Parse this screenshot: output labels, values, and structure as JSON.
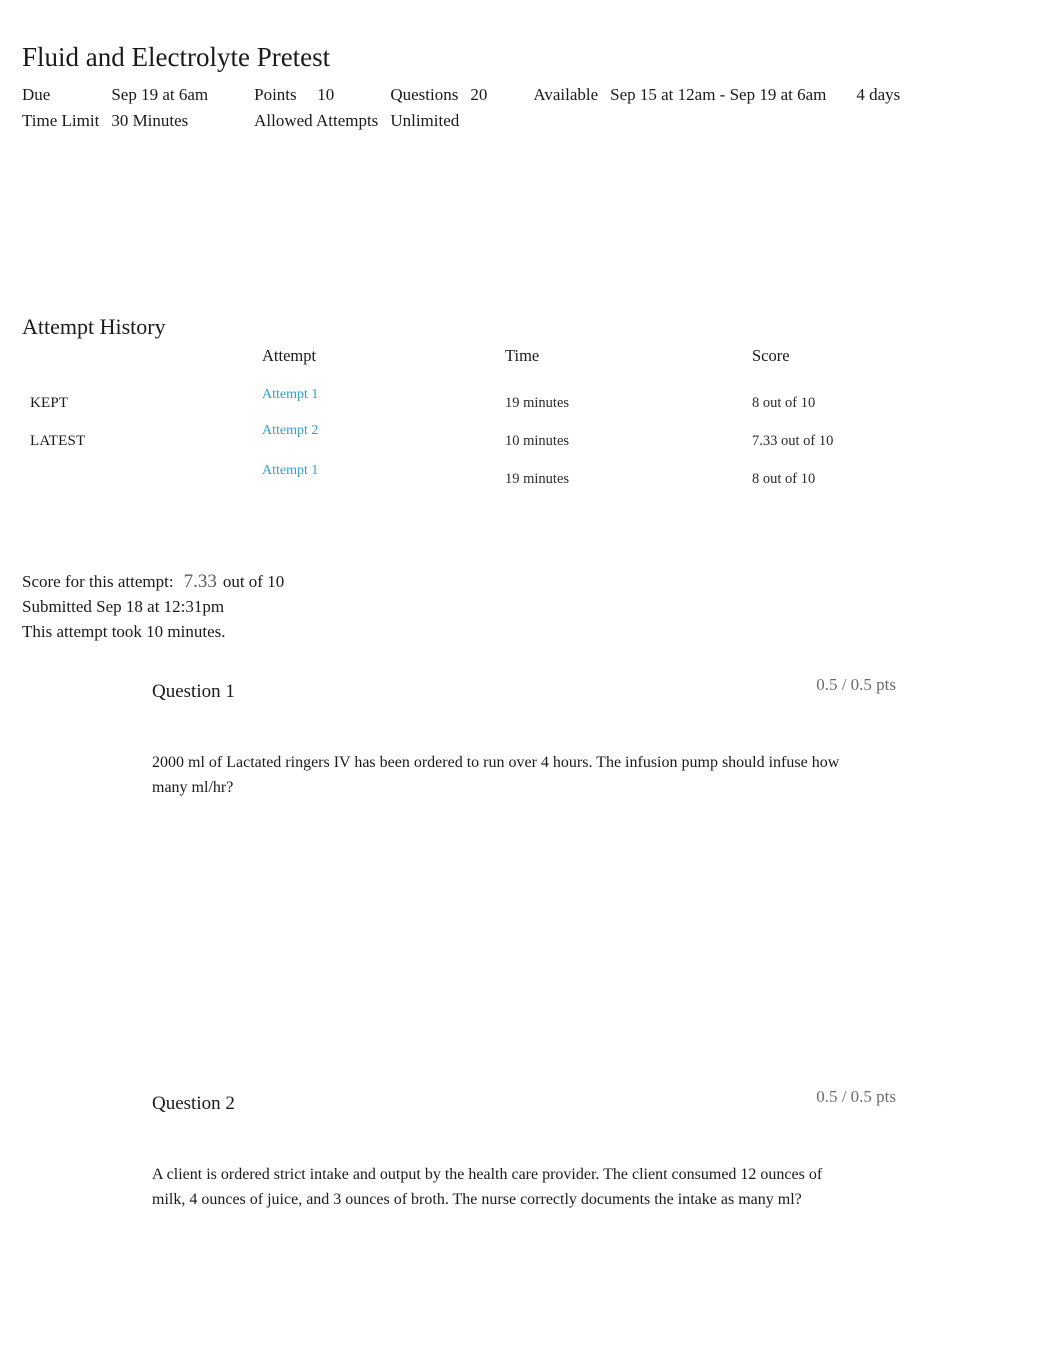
{
  "quiz": {
    "title": "Fluid and Electrolyte Pretest",
    "meta": {
      "due_label": "Due",
      "due_value": "Sep 19 at 6am",
      "points_label": "Points",
      "points_value": "10",
      "questions_label": "Questions",
      "questions_value": "20",
      "available_label": "Available",
      "available_value": "Sep 15 at 12am - Sep 19 at 6am",
      "available_duration": "4 days",
      "time_limit_label": "Time Limit",
      "time_limit_value": "30 Minutes",
      "allowed_attempts_label": "Allowed Attempts",
      "allowed_attempts_value": "Unlimited"
    }
  },
  "attempt_history": {
    "heading": "Attempt History",
    "columns": {
      "kind": "",
      "attempt": "Attempt",
      "time": "Time",
      "score": "Score"
    },
    "rows": [
      {
        "kind": "KEPT",
        "attempt": "Attempt 1",
        "time": "19 minutes",
        "score": "8 out of 10"
      },
      {
        "kind": "LATEST",
        "attempt": "Attempt 2",
        "time": "10 minutes",
        "score": "7.33 out of 10"
      },
      {
        "kind": "",
        "attempt": "Attempt 1",
        "time": "19 minutes",
        "score": "8 out of 10"
      }
    ]
  },
  "score_summary": {
    "score_label": "Score for this attempt:",
    "score_value": "7.33",
    "score_out_of": "out of 10",
    "submitted": "Submitted Sep 18 at 12:31pm",
    "duration": "This attempt took 10 minutes."
  },
  "questions": [
    {
      "name": "Question 1",
      "points": "0.5 / 0.5 pts",
      "text": "2000 ml of Lactated ringers IV has been ordered to run over 4 hours. The infusion pump should infuse how many ml/hr?"
    },
    {
      "name": "Question 2",
      "points": "0.5 / 0.5 pts",
      "text": "A client is ordered strict intake and output by the health care provider. The client consumed 12 ounces of milk, 4 ounces of juice, and 3 ounces of broth. The nurse correctly documents the intake as many ml?"
    }
  ],
  "colors": {
    "link": "#2f9fd8",
    "muted": "#6b6b6b",
    "text": "#1a1a1a"
  }
}
